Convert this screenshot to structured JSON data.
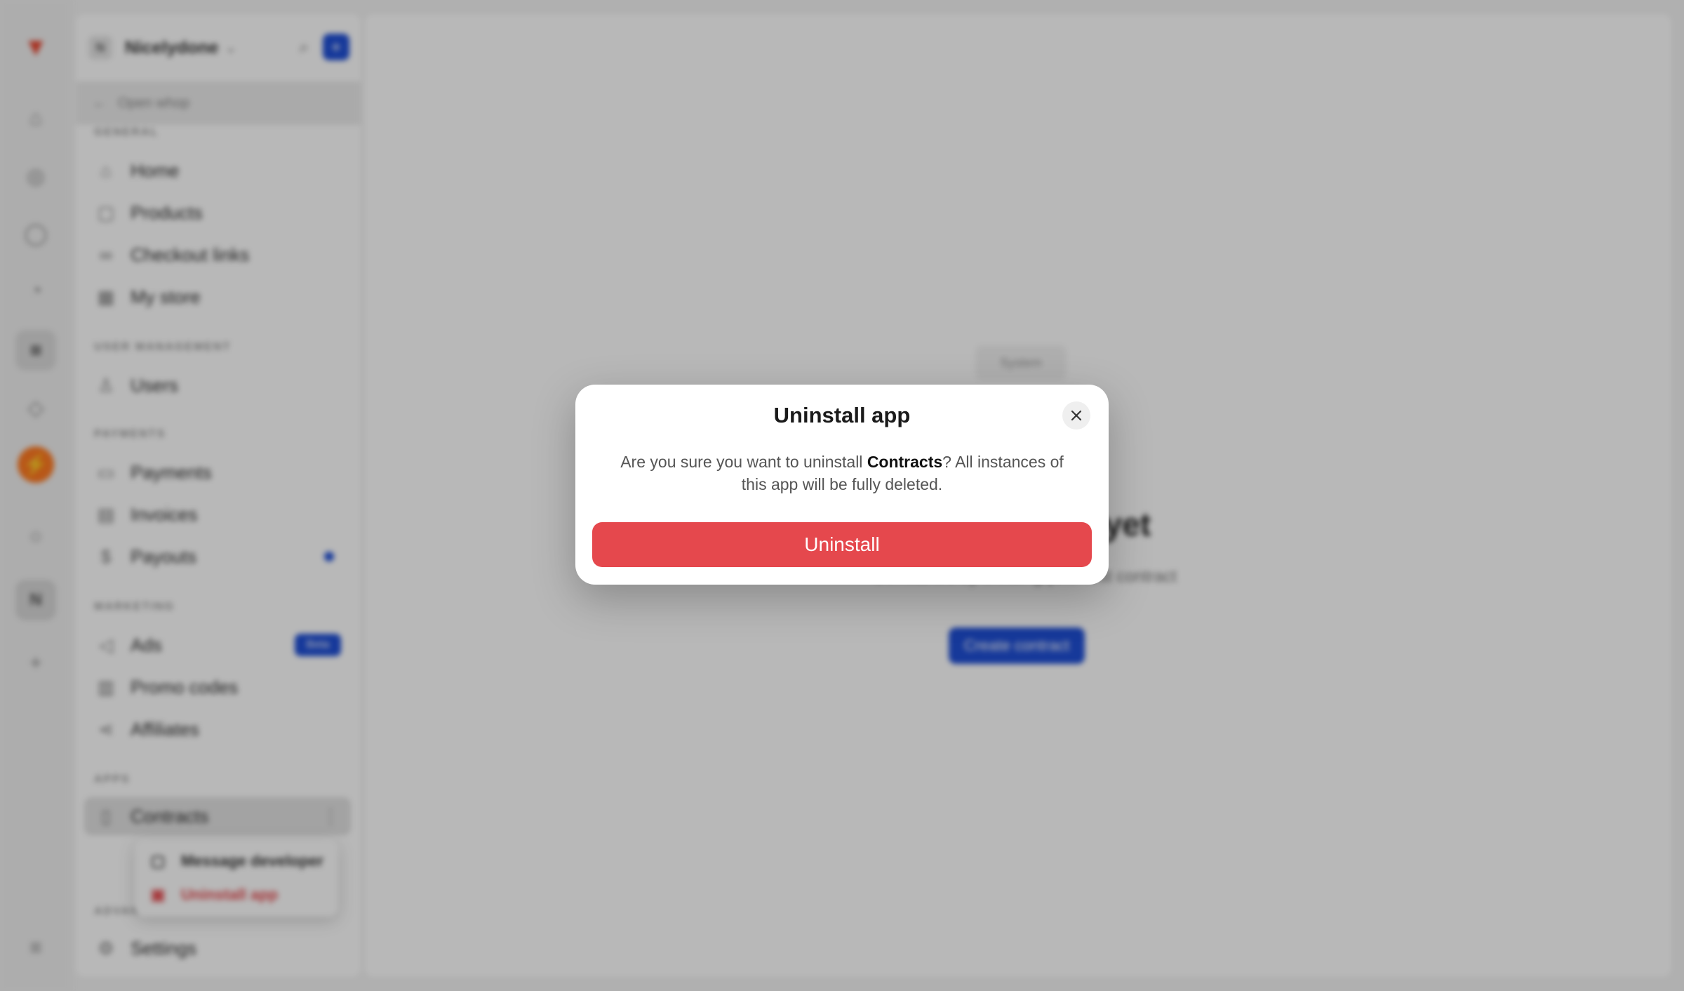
{
  "colors": {
    "accent_blue": "#1f4fd6",
    "danger_red": "#e5484d",
    "brand_orange": "#ff7a22"
  },
  "rail": {
    "icons": [
      "home-icon",
      "compass-icon",
      "chat-icon",
      "bell-icon",
      "app-icon",
      "tag-icon",
      "orange-app-icon",
      "search-icon",
      "workspace-icon",
      "plus-icon",
      "collapse-icon"
    ],
    "workspace_initial": "N"
  },
  "sidebar": {
    "workspace_initial": "N",
    "workspace_name": "Nicelydone",
    "open_whop_label": "Open whop",
    "sections": {
      "general": "GENERAL",
      "user_management": "USER MANAGEMENT",
      "payments": "PAYMENTS",
      "marketing": "MARKETING",
      "apps": "APPS",
      "advanced": "ADVANCED"
    },
    "items": {
      "home": "Home",
      "products": "Products",
      "checkout_links": "Checkout links",
      "my_store": "My store",
      "users": "Users",
      "payments": "Payments",
      "invoices": "Invoices",
      "payouts": "Payouts",
      "ads": "Ads",
      "ads_badge": "Beta",
      "promo_codes": "Promo codes",
      "affiliates": "Affiliates",
      "contracts": "Contracts",
      "settings": "Settings"
    },
    "context_menu": {
      "message_developer": "Message developer",
      "uninstall_app": "Uninstall app"
    }
  },
  "main": {
    "chip_label": "System",
    "empty_title": "No contracts yet",
    "empty_subtitle": "Get started by creating your first contract",
    "create_button": "Create contract"
  },
  "modal": {
    "title": "Uninstall app",
    "body_prefix": "Are you sure you want to uninstall ",
    "app_name": "Contracts",
    "body_suffix": "? All instances of this app will be fully deleted.",
    "confirm_label": "Uninstall"
  }
}
